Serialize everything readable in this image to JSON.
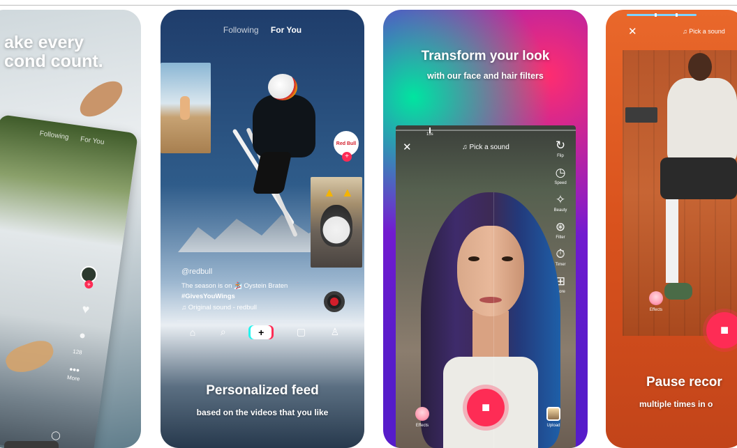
{
  "colors": {
    "brand_red": "#fe2c55",
    "brand_cyan": "#25f4ee",
    "text_white": "#ffffff"
  },
  "card1": {
    "headline": "ake every\ncond count.",
    "tabs": [
      "Following",
      "For You"
    ],
    "count": "128",
    "more_label": "More",
    "icons": [
      "heart-icon",
      "comment-icon",
      "more-icon",
      "home-icon",
      "profile-icon"
    ]
  },
  "card2": {
    "tabs": {
      "following": "Following",
      "for_you": "For You"
    },
    "brand_logo": "Red Bull",
    "username": "@redbull",
    "caption": "The season is on 🏂 Oystein Braten",
    "hashtag": "#GivesYouWings",
    "sound": "♫ Original sound - redbull",
    "nav": [
      "home-icon",
      "search-icon",
      "create-icon",
      "inbox-icon",
      "profile-icon"
    ],
    "headline": "Personalized feed",
    "subheadline": "based on the videos that you like"
  },
  "card3": {
    "headline": "Transform your look",
    "subheadline": "with our face and hair filters",
    "timer": "15s",
    "pick_sound": "♫ Pick a sound",
    "tools": [
      {
        "icon": "↻",
        "label": "Flip",
        "name": "flip"
      },
      {
        "icon": "◷",
        "label": "Speed",
        "name": "speed"
      },
      {
        "icon": "✧",
        "label": "Beauty",
        "name": "beauty"
      },
      {
        "icon": "⊛",
        "label": "Filter",
        "name": "filter"
      },
      {
        "icon": "⏱",
        "label": "Timer",
        "name": "timer"
      },
      {
        "icon": "⊞",
        "label": "More",
        "name": "more"
      }
    ],
    "effects_label": "Effects",
    "upload_label": "Upload"
  },
  "card4": {
    "pick_sound": "♫ Pick a sound",
    "effects_label": "Effects",
    "headline": "Pause recor",
    "subheadline": "multiple times in o"
  }
}
